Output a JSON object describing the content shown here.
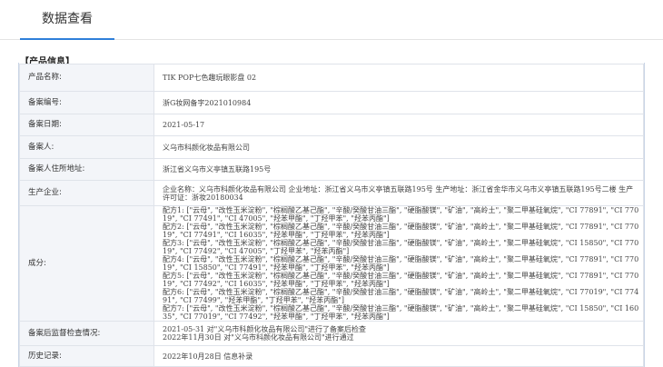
{
  "tabs": {
    "active_label": "数据查看"
  },
  "section": {
    "title": "【产品信息】"
  },
  "rows": {
    "product_name": {
      "label": "产品名称:",
      "value": "TIK POP七色趣玩眼影盘 02"
    },
    "record_no": {
      "label": "备案编号:",
      "value": "浙G妆网备字2021010984"
    },
    "record_date": {
      "label": "备案日期:",
      "value": "2021-05-17"
    },
    "registrant": {
      "label": "备案人:",
      "value": "义乌市科颜化妆品有限公司"
    },
    "registrant_address": {
      "label": "备案人住所地址:",
      "value": "浙江省义乌市义亭镇五联路195号"
    },
    "manufacturer": {
      "label": "生产企业:",
      "value": "企业名称：义乌市科颜化妆品有限公司 企业地址：浙江省义乌市义亭镇五联路195号 生产地址：浙江省金华市义乌市义亭镇五联路195号二楼 生产许可证：浙妆20180034"
    },
    "ingredients": {
      "label": "成分:",
      "formulas": [
        "配方1: [\"云母\", \"改性玉米淀粉\", \"棕榈酸乙基己酯\", \"辛酸/癸酸甘油三酯\", \"硬脂酸镁\", \"矿油\", \"高岭土\", \"聚二甲基硅氧烷\", \"CI 77891\", \"CI 77019\", \"CI 77491\", \"CI 47005\", \"羟苯甲酯\", \"丁羟甲苯\", \"羟苯丙酯\"]",
        "配方2: [\"云母\", \"改性玉米淀粉\", \"棕榈酸乙基己酯\", \"辛酸/癸酸甘油三酯\", \"硬脂酸镁\", \"矿油\", \"高岭土\", \"聚二甲基硅氧烷\", \"CI 77891\", \"CI 77019\", \"CI 77491\", \"CI 16035\", \"羟苯甲酯\", \"丁羟甲苯\", \"羟苯丙酯\"]",
        "配方3: [\"云母\", \"改性玉米淀粉\", \"棕榈酸乙基己酯\", \"辛酸/癸酸甘油三酯\", \"硬脂酸镁\", \"矿油\", \"高岭土\", \"聚二甲基硅氧烷\", \"CI 15850\", \"CI 77019\", \"CI 77492\", \"CI 47005\", \"丁羟甲苯\", \"羟苯丙酯\"]",
        "配方4: [\"云母\", \"改性玉米淀粉\", \"棕榈酸乙基己酯\", \"辛酸/癸酸甘油三酯\", \"硬脂酸镁\", \"矿油\", \"高岭土\", \"聚二甲基硅氧烷\", \"CI 77891\", \"CI 77019\", \"CI 15850\", \"CI 77491\", \"羟苯甲酯\", \"丁羟甲苯\", \"羟苯丙酯\"]",
        "配方5: [\"云母\", \"改性玉米淀粉\", \"棕榈酸乙基己酯\", \"辛酸/癸酸甘油三酯\", \"硬脂酸镁\", \"矿油\", \"高岭土\", \"聚二甲基硅氧烷\", \"CI 77891\", \"CI 77019\", \"CI 77492\", \"CI 16035\", \"羟苯甲酯\", \"丁羟甲苯\", \"羟苯丙酯\"]",
        "配方6: [\"云母\", \"改性玉米淀粉\", \"棕榈酸乙基己酯\", \"辛酸/癸酸甘油三酯\", \"硬脂酸镁\", \"矿油\", \"高岭土\", \"聚二甲基硅氧烷\", \"CI 77019\", \"CI 77491\", \"CI 77499\", \"羟苯甲酯\", \"丁羟甲苯\", \"羟苯丙酯\"]",
        "配方7: [\"云母\", \"改性玉米淀粉\", \"棕榈酸乙基己酯\", \"辛酸/癸酸甘油三酯\", \"硬脂酸镁\", \"矿油\", \"高岭土\", \"聚二甲基硅氧烷\", \"CI 15850\", \"CI 16035\", \"CI 77019\", \"CI 77492\", \"羟苯甲酯\", \"丁羟甲苯\", \"羟苯丙酯\"]"
      ]
    },
    "post_inspection": {
      "label": "备案后监督检查情况:",
      "lines": [
        "2021-05-31 对\"义乌市科颜化妆品有限公司\"进行了备案后检查",
        "2022年11月30日 对\"义乌市科颜化妆品有限公司\"进行通过"
      ]
    },
    "history": {
      "label": "历史记录:",
      "value": "2022年10月28日 信息补录"
    }
  }
}
